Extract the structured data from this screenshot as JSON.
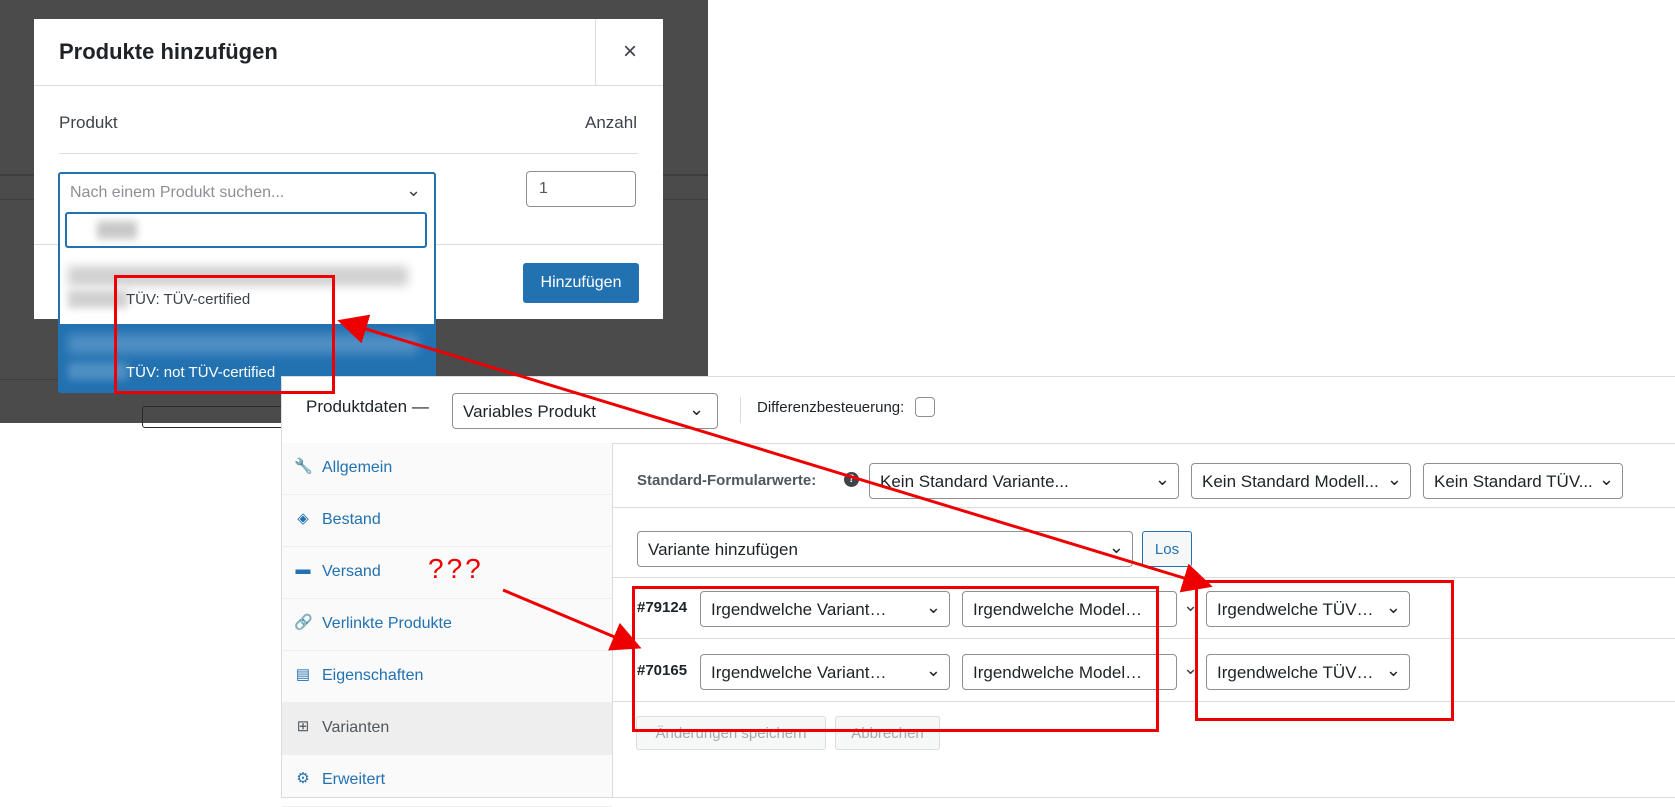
{
  "modal": {
    "title": "Produkte hinzufügen",
    "close": "×",
    "col_product": "Produkt",
    "col_qty": "Anzahl",
    "qty_value": "1",
    "add_button": "Hinzufügen",
    "search_placeholder": "Nach einem Produkt suchen...",
    "option1_label": "TÜV: TÜV-certified",
    "option2_label": "TÜV: not TÜV-certified"
  },
  "product_data": {
    "title": "Produktdaten —",
    "type": "Variables Produkt",
    "diff_label": "Differenzbesteuerung:",
    "sidebar": [
      {
        "icon": "wrench-icon",
        "glyph": "🔧",
        "label": "Allgemein"
      },
      {
        "icon": "tag-icon",
        "glyph": "◈",
        "label": "Bestand"
      },
      {
        "icon": "truck-icon",
        "glyph": "▬",
        "label": "Versand"
      },
      {
        "icon": "link-icon",
        "glyph": "🔗",
        "label": "Verlinkte Produkte"
      },
      {
        "icon": "list-icon",
        "glyph": "▤",
        "label": "Eigenschaften"
      },
      {
        "icon": "grid-icon",
        "glyph": "⊞",
        "label": "Varianten"
      },
      {
        "icon": "gear-icon",
        "glyph": "⚙",
        "label": "Erweitert"
      }
    ],
    "defaults_label": "Standard-Formularwerte:",
    "defaults": [
      "Kein Standard Variante...",
      "Kein Standard Modell...",
      "Kein Standard TÜV..."
    ],
    "add_variation": "Variante hinzufügen",
    "go_button": "Los",
    "variations": [
      {
        "id": "#79124",
        "variant": "Irgendwelche Variant…",
        "model": "Irgendwelche Model…",
        "tuv": "Irgendwelche TÜV…"
      },
      {
        "id": "#70165",
        "variant": "Irgendwelche Variant…",
        "model": "Irgendwelche Model…",
        "tuv": "Irgendwelche TÜV…"
      }
    ],
    "save_button": "Änderungen speichern",
    "cancel_button": "Abbrechen"
  },
  "annotation": {
    "question": "???",
    "color": "#ee0000"
  }
}
